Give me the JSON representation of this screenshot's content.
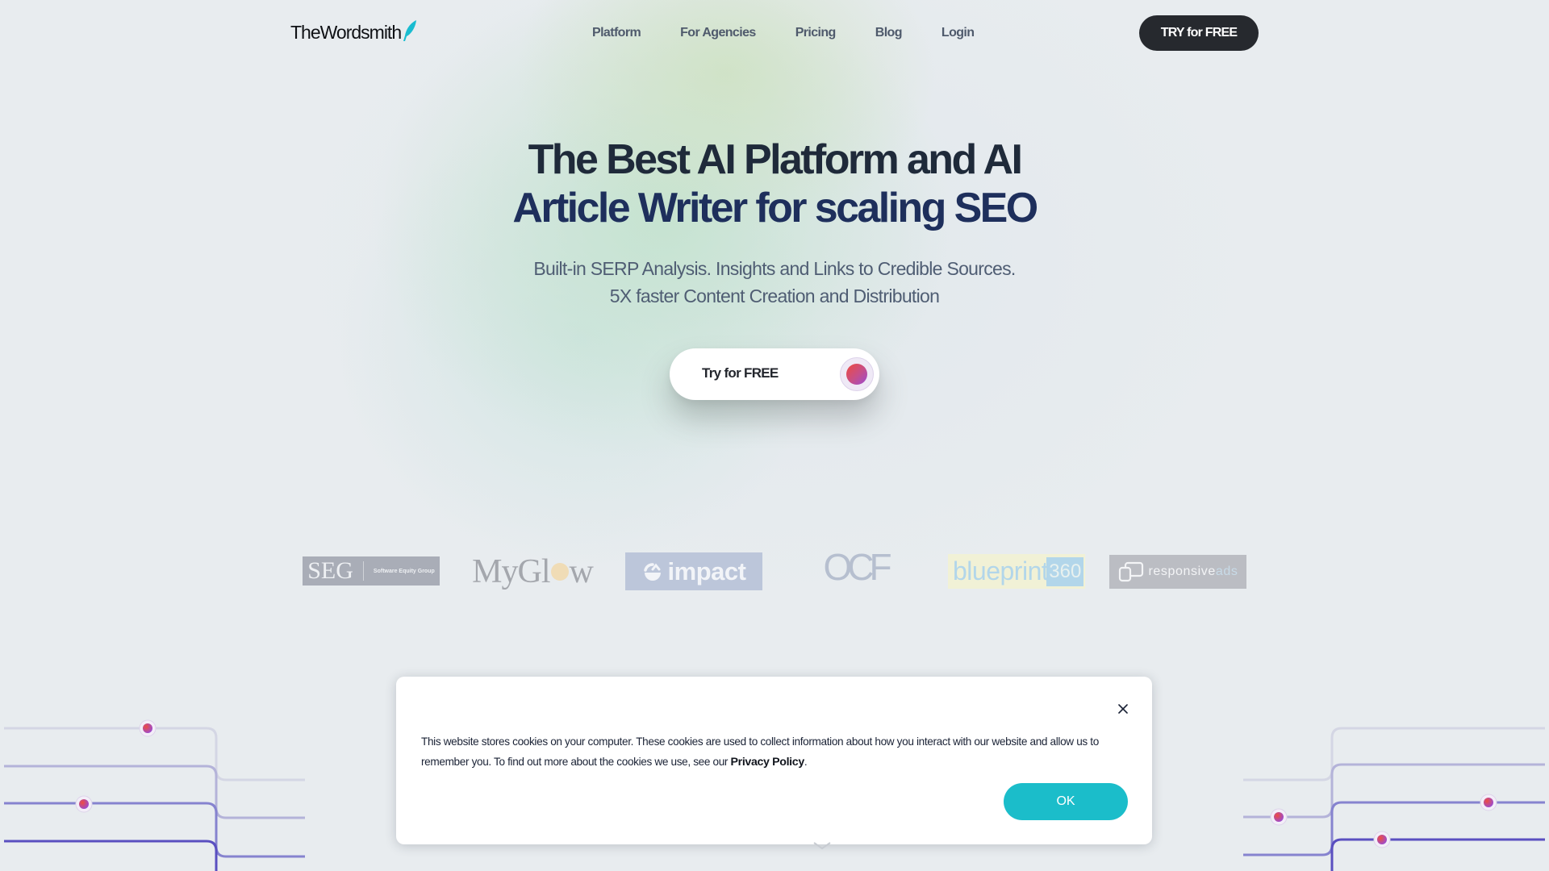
{
  "brand": {
    "name": "TheWordsmith",
    "accent": "#1bbdca"
  },
  "nav": {
    "items": [
      {
        "label": "Platform"
      },
      {
        "label": "For Agencies"
      },
      {
        "label": "Pricing"
      },
      {
        "label": "Blog"
      },
      {
        "label": "Login"
      }
    ],
    "cta_label": "TRY for FREE"
  },
  "hero": {
    "title_line1": "The Best AI Platform and AI",
    "title_line2": "Article Writer for scaling SEO",
    "subtitle_line1": "Built-in SERP Analysis. Insights and Links to Credible Sources.",
    "subtitle_line2": "5X faster Content Creation and Distribution",
    "cta_label": "Try for FREE"
  },
  "clients": {
    "seg": {
      "name": "SEG",
      "tagline": "Software Equity Group"
    },
    "myglow": {
      "part1": "MyGl",
      "part2": "w"
    },
    "impact": {
      "name": "impact"
    },
    "ocf": {
      "name": "OCF"
    },
    "blueprint": {
      "name": "blueprint",
      "suffix": "360"
    },
    "responsiveads": {
      "name": "responsive",
      "suffix": "ads"
    }
  },
  "cookie_banner": {
    "text_before": "This website stores cookies on your computer. These cookies are used to collect information about how you interact with our website and allow us to remember you. To find out more about the cookies we use, see our ",
    "link_label": "Privacy Policy",
    "text_after": ".",
    "ok_label": "OK"
  },
  "colors": {
    "nav_button_bg": "#26292e",
    "ok_button_bg": "#1bbdca",
    "dot_gradient_start": "#ee4a3e",
    "dot_gradient_end": "#9b4bd1"
  }
}
